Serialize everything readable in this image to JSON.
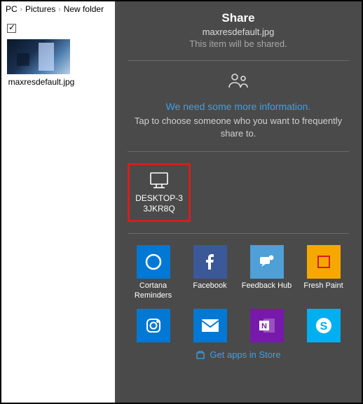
{
  "breadcrumb": {
    "seg0": "PC",
    "seg1": "Pictures",
    "seg2": "New folder"
  },
  "thumbnail": {
    "filename": "maxresdefault.jpg"
  },
  "share": {
    "title": "Share",
    "filename": "maxresdefault.jpg",
    "subtitle": "This item will be shared.",
    "info_heading": "We need some more information.",
    "info_text": "Tap to choose someone who you want to frequently share to.",
    "device": {
      "line1": "DESKTOP-3",
      "line2": "3JKR8Q"
    },
    "apps_row1": [
      {
        "label": "Cortana Reminders"
      },
      {
        "label": "Facebook"
      },
      {
        "label": "Feedback Hub"
      },
      {
        "label": "Fresh Paint"
      }
    ],
    "apps_row2_icons": [
      "instagram",
      "mail",
      "onenote",
      "skype"
    ],
    "store_link": "Get apps in Store"
  }
}
